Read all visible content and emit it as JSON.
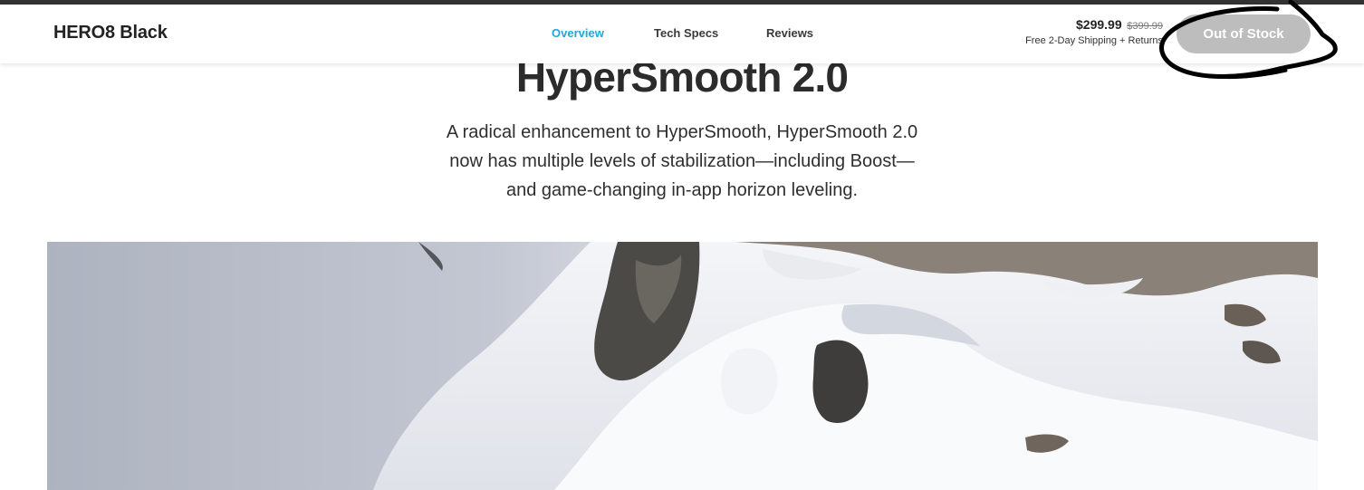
{
  "header": {
    "product_name": "HERO8 Black",
    "nav": [
      {
        "label": "Overview",
        "active": true
      },
      {
        "label": "Tech Specs",
        "active": false
      },
      {
        "label": "Reviews",
        "active": false
      }
    ],
    "price": "$299.99",
    "original_price": "$399.99",
    "shipping": "Free 2-Day Shipping + Returns",
    "stock_button": "Out of Stock"
  },
  "main": {
    "headline": "HyperSmooth 2.0",
    "description_lines": [
      "A radical enhancement to HyperSmooth, HyperSmooth 2.0",
      "now has multiple levels of stabilization—including Boost—",
      "and game-changing in-app horizon leveling."
    ]
  },
  "colors": {
    "accent": "#1fa9d8",
    "button_disabled": "#bdbdbd",
    "annotation": "#000000"
  },
  "icons": {
    "annotation": "hand-drawn-circle-icon",
    "hero": "snowy-mountain-image"
  }
}
